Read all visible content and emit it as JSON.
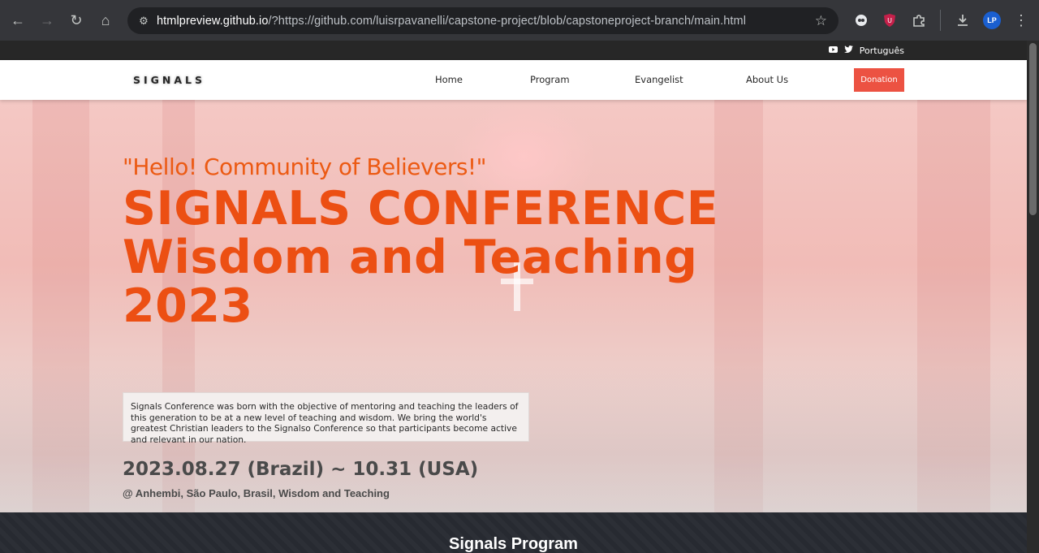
{
  "browser": {
    "url_host": "htmlpreview.github.io",
    "url_rest": "/?https://github.com/luisrpavanelli/capstone-project/blob/capstoneproject-branch/main.html",
    "profile_initials": "LP"
  },
  "topbar": {
    "language": "Português"
  },
  "header": {
    "logo": "SIGNALS",
    "menu": [
      "Home",
      "Program",
      "Evangelist",
      "About Us"
    ],
    "donation": "Donation"
  },
  "hero": {
    "greeting": "\"Hello! Community of Believers!\"",
    "title_line1": "SIGNALS CONFERENCE",
    "title_line2": "Wisdom and Teaching",
    "title_line3": "2023",
    "description": "Signals Conference was born with the objective of mentoring and teaching the leaders of this generation to be at a new level of teaching and wisdom. We bring the world's greatest Christian leaders to the Signalso Conference so that participants become active and relevant in our nation.",
    "dates": "2023.08.27 (Brazil) ~ 10.31 (USA)",
    "venue": "@ Anhembi, São Paulo, Brasil, Wisdom and Teaching"
  },
  "program": {
    "title": "Signals Program"
  },
  "colors": {
    "accent": "#ec5242",
    "title": "#ec4f13",
    "dark": "#272727"
  }
}
